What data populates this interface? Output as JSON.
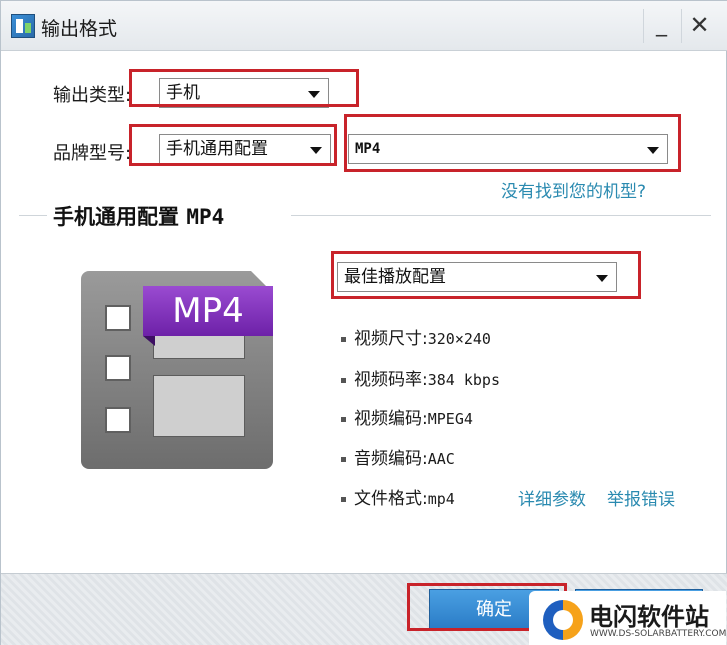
{
  "window": {
    "title": "输出格式",
    "minimize_glyph": "_",
    "close_glyph": "✕"
  },
  "form": {
    "output_type": {
      "label": "输出类型:",
      "value": "手机"
    },
    "brand_model": {
      "label": "品牌型号:",
      "brand_value": "手机通用配置",
      "format_value": "MP4"
    },
    "not_found_link": "没有找到您的机型?"
  },
  "section": {
    "title_cn": "手机通用配置",
    "title_fmt": "MP4"
  },
  "preset": {
    "value": "最佳播放配置"
  },
  "format_badge": "MP4",
  "specs": [
    {
      "label": "视频尺寸:",
      "value": "320×240"
    },
    {
      "label": "视频码率:",
      "value": "384 kbps"
    },
    {
      "label": "视频编码:",
      "value": "MPEG4"
    },
    {
      "label": "音频编码:",
      "value": "AAC"
    },
    {
      "label": "文件格式:",
      "value": "mp4"
    }
  ],
  "links": {
    "details": "详细参数",
    "report": "举报错误"
  },
  "buttons": {
    "ok": "确定"
  },
  "watermark": {
    "title": "电闪软件站",
    "subtitle": "WWW.DS-SOLARBATTERY.COM"
  },
  "colors": {
    "highlight_box": "#c8232a",
    "button_blue": "#2b7dc7",
    "link": "#2a8ab0",
    "badge_purple": "#7a2cb4"
  }
}
